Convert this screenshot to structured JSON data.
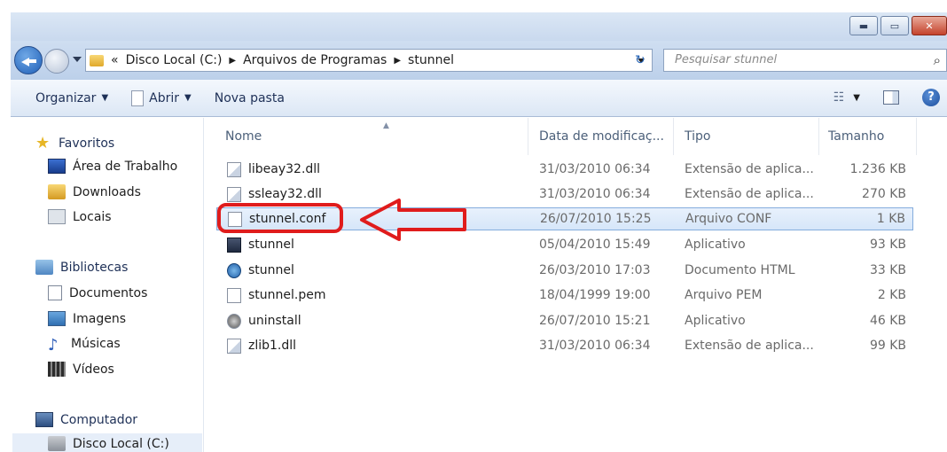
{
  "address": {
    "overflow_chevrons": "«",
    "crumbs": [
      "Disco Local (C:)",
      "Arquivos de Programas",
      "stunnel"
    ],
    "search_placeholder": "Pesquisar stunnel"
  },
  "toolbar": {
    "organize": "Organizar",
    "open": "Abrir",
    "new_folder": "Nova pasta"
  },
  "sidebar": {
    "favorites": "Favoritos",
    "fav_items": [
      "Área de Trabalho",
      "Downloads",
      "Locais"
    ],
    "libraries": "Bibliotecas",
    "lib_items": [
      "Documentos",
      "Imagens",
      "Músicas",
      "Vídeos"
    ],
    "computer": "Computador",
    "computer_items": [
      "Disco Local (C:)"
    ]
  },
  "columns": {
    "name": "Nome",
    "date": "Data de modificaç...",
    "type": "Tipo",
    "size": "Tamanho"
  },
  "files": [
    {
      "name": "libeay32.dll",
      "date": "31/03/2010 06:34",
      "type": "Extensão de aplica...",
      "size": "1.236 KB",
      "icon": "dll-icon"
    },
    {
      "name": "ssleay32.dll",
      "date": "31/03/2010 06:34",
      "type": "Extensão de aplica...",
      "size": "270 KB",
      "icon": "dll-icon"
    },
    {
      "name": "stunnel.conf",
      "date": "26/07/2010 15:25",
      "type": "Arquivo CONF",
      "size": "1 KB",
      "icon": "file-icon",
      "selected": true
    },
    {
      "name": "stunnel",
      "date": "05/04/2010 15:49",
      "type": "Aplicativo",
      "size": "93 KB",
      "icon": "exe-icon"
    },
    {
      "name": "stunnel",
      "date": "26/03/2010 17:03",
      "type": "Documento HTML",
      "size": "33 KB",
      "icon": "html-icon"
    },
    {
      "name": "stunnel.pem",
      "date": "18/04/1999 19:00",
      "type": "Arquivo PEM",
      "size": "2 KB",
      "icon": "file-icon"
    },
    {
      "name": "uninstall",
      "date": "26/07/2010 15:21",
      "type": "Aplicativo",
      "size": "46 KB",
      "icon": "uninstall-icon"
    },
    {
      "name": "zlib1.dll",
      "date": "31/03/2010 06:34",
      "type": "Extensão de aplica...",
      "size": "99 KB",
      "icon": "dll-icon"
    }
  ],
  "colors": {
    "selection_border": "#84acdd",
    "annotation_red": "#e01c1c"
  }
}
